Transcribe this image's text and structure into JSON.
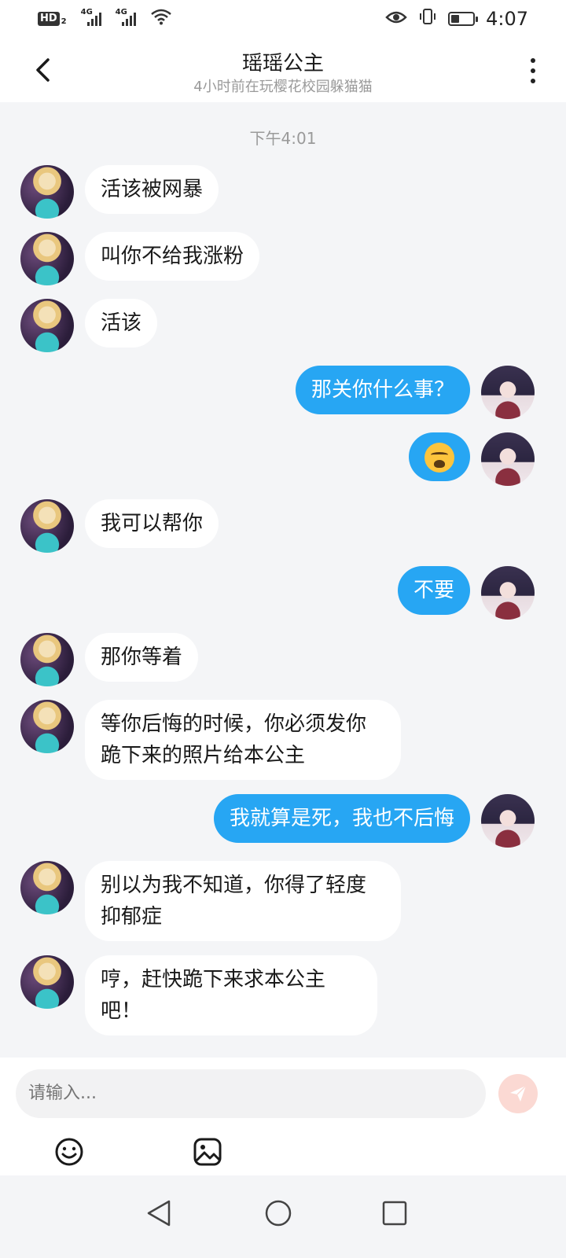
{
  "status_bar": {
    "hd_label": "HD",
    "hd_sub": "2",
    "network_1": "4G",
    "network_2": "4G",
    "time": "4:07"
  },
  "header": {
    "title": "瑶瑶公主",
    "subtitle": "4小时前在玩樱花校园躲猫猫"
  },
  "chat": {
    "timestamp": "下午4:01",
    "messages": [
      {
        "side": "in",
        "text": "活该被网暴"
      },
      {
        "side": "in",
        "text": "叫你不给我涨粉"
      },
      {
        "side": "in",
        "text": "活该"
      },
      {
        "side": "out",
        "text": "那关你什么事？"
      },
      {
        "side": "out",
        "emoji": "loudly-crying-face"
      },
      {
        "side": "in",
        "text": "我可以帮你"
      },
      {
        "side": "out",
        "text": "不要"
      },
      {
        "side": "in",
        "text": "那你等着"
      },
      {
        "side": "in",
        "text": "等你后悔的时候，你必须发你跪下来的照片给本公主"
      },
      {
        "side": "out",
        "text": "我就算是死，我也不后悔"
      },
      {
        "side": "in",
        "text": "别以为我不知道，你得了轻度抑郁症"
      },
      {
        "side": "in",
        "text": "哼，赶快跪下来求本公主吧！"
      }
    ]
  },
  "input": {
    "placeholder": "请输入..."
  },
  "colors": {
    "outgoing_bubble": "#27a6f3",
    "incoming_bubble": "#ffffff",
    "send_button": "#fbd9d3",
    "chat_background": "#f4f5f7"
  },
  "icons": [
    "back-arrow-icon",
    "more-vertical-icon",
    "send-icon",
    "emoji-icon",
    "image-icon",
    "nav-back-icon",
    "nav-home-icon",
    "nav-recents-icon"
  ]
}
